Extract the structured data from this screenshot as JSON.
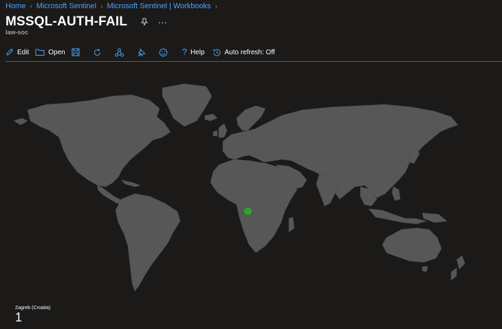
{
  "breadcrumb": [
    "Home",
    "Microsoft Sentinel",
    "Microsoft Sentinel | Workbooks"
  ],
  "title": "MSSQL-AUTH-FAIL",
  "subtitle": "law-soc",
  "toolbar": {
    "edit": "Edit",
    "open": "Open",
    "help": "Help",
    "auto_refresh": "Auto refresh: Off",
    "icons": [
      "edit-icon",
      "open-folder-icon",
      "save-icon",
      "refresh-icon",
      "share-icon",
      "pin-icon",
      "feedback-smiley-icon",
      "help-icon",
      "auto-refresh-clock-icon"
    ]
  },
  "map": {
    "land_color": "#575757",
    "background_color": "#1b1a19",
    "marker_color": "#2aa52a",
    "legend": {
      "label": "Zagreb (Croatia)",
      "count": "1"
    }
  }
}
